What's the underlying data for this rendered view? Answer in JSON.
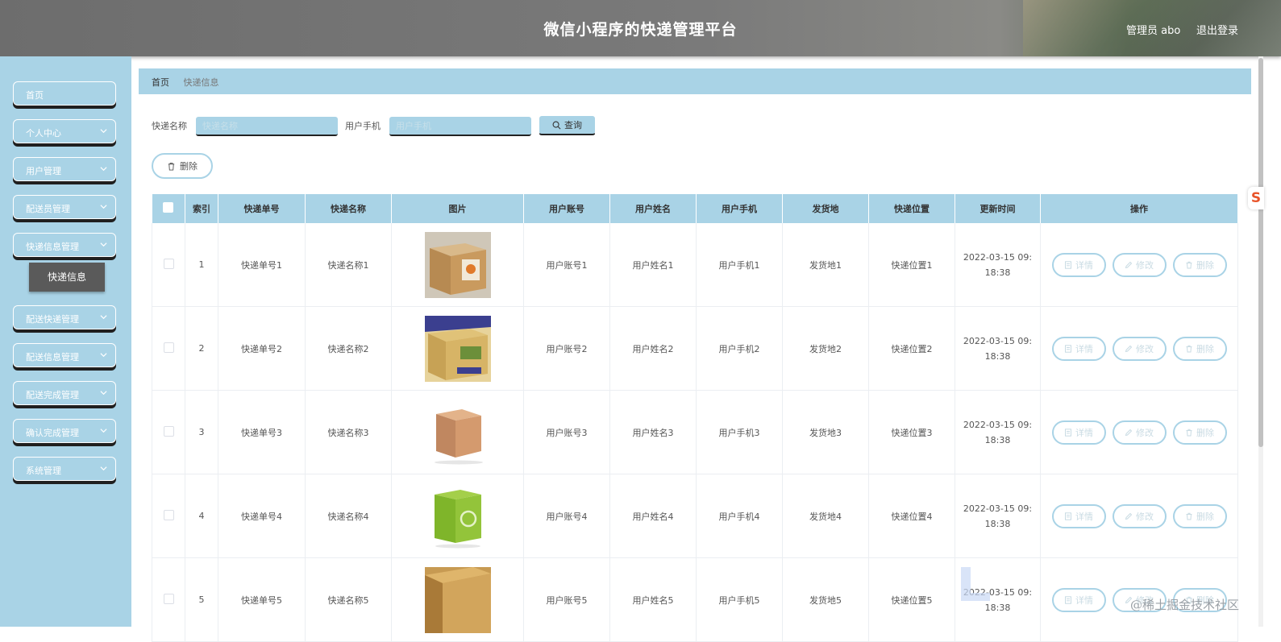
{
  "header": {
    "title": "微信小程序的快递管理平台",
    "admin_label": "管理员 abo",
    "logout_label": "退出登录"
  },
  "sidebar": {
    "items": [
      {
        "label": "首页",
        "has_arrow": false
      },
      {
        "label": "个人中心",
        "has_arrow": true
      },
      {
        "label": "用户管理",
        "has_arrow": true
      },
      {
        "label": "配送员管理",
        "has_arrow": true
      },
      {
        "label": "快递信息管理",
        "has_arrow": true
      },
      {
        "label": "配送快递管理",
        "has_arrow": true
      },
      {
        "label": "配送信息管理",
        "has_arrow": true
      },
      {
        "label": "配送完成管理",
        "has_arrow": true
      },
      {
        "label": "确认完成管理",
        "has_arrow": true
      },
      {
        "label": "系统管理",
        "has_arrow": true
      }
    ],
    "active_sub": "快递信息"
  },
  "breadcrumb": {
    "home": "首页",
    "current": "快递信息"
  },
  "search": {
    "name_label": "快递名称",
    "name_placeholder": "快递名称",
    "phone_label": "用户手机",
    "phone_placeholder": "用户手机",
    "query_label": "查询"
  },
  "actions": {
    "delete_label": "删除"
  },
  "table": {
    "headers": [
      "索引",
      "快递单号",
      "快递名称",
      "图片",
      "用户账号",
      "用户姓名",
      "用户手机",
      "发货地",
      "快递位置",
      "更新时间",
      "操作"
    ],
    "rows": [
      {
        "index": "1",
        "no": "快递单号1",
        "name": "快递名称1",
        "image": "box-with-label",
        "account": "用户账号1",
        "uname": "用户姓名1",
        "phone": "用户手机1",
        "origin": "发货地1",
        "location": "快递位置1",
        "time_line1": "2022-03-15 09:",
        "time_line2": "18:38"
      },
      {
        "index": "2",
        "no": "快递单号2",
        "name": "快递名称2",
        "image": "printed-box",
        "account": "用户账号2",
        "uname": "用户姓名2",
        "phone": "用户手机2",
        "origin": "发货地2",
        "location": "快递位置2",
        "time_line1": "2022-03-15 09:",
        "time_line2": "18:38"
      },
      {
        "index": "3",
        "no": "快递单号3",
        "name": "快递名称3",
        "image": "plain-box",
        "account": "用户账号3",
        "uname": "用户姓名3",
        "phone": "用户手机3",
        "origin": "发货地3",
        "location": "快递位置3",
        "time_line1": "2022-03-15 09:",
        "time_line2": "18:38"
      },
      {
        "index": "4",
        "no": "快递单号4",
        "name": "快递名称4",
        "image": "green-recycle-box",
        "account": "用户账号4",
        "uname": "用户姓名4",
        "phone": "用户手机4",
        "origin": "发货地4",
        "location": "快递位置4",
        "time_line1": "2022-03-15 09:",
        "time_line2": "18:38"
      },
      {
        "index": "5",
        "no": "快递单号5",
        "name": "快递名称5",
        "image": "flat-box",
        "account": "用户账号5",
        "uname": "用户姓名5",
        "phone": "用户手机5",
        "origin": "发货地5",
        "location": "快递位置5",
        "time_line1": "2022-03-15 09:",
        "time_line2": "18:38"
      }
    ],
    "row_actions": {
      "detail": "详情",
      "edit": "修改",
      "delete": "删除"
    }
  },
  "overlay": {
    "float_tab": "S",
    "watermark": "@稀土掘金技术社区"
  },
  "colors": {
    "accent": "#a9d3e6",
    "header": "#777777",
    "active_sub": "#5a5a5a",
    "button_shadow": "#1f1f1f"
  }
}
